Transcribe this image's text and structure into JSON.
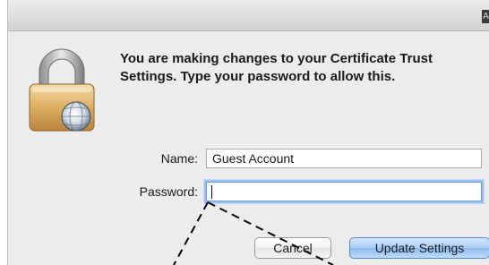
{
  "dialog": {
    "corner_glyph": "A",
    "message": "You are making changes to your Certificate Trust Settings. Type your password to allow this.",
    "name_label": "Name:",
    "name_value": "Guest Account",
    "password_label": "Password:",
    "password_value": "",
    "cancel_label": "Cancel",
    "update_label": "Update Settings"
  },
  "icons": {
    "lock": "padlock-icon",
    "corner": "app-icon"
  },
  "colors": {
    "dialog_bg": "#ececec",
    "default_button": "#a8cdf5",
    "focus_ring": "#9cc0ef"
  }
}
